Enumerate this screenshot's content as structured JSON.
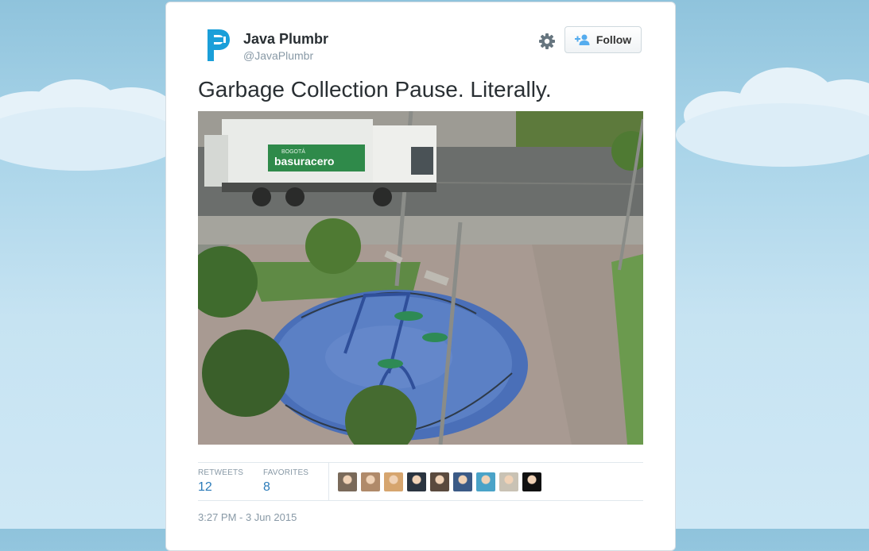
{
  "user": {
    "name": "Java Plumbr",
    "handle": "@JavaPlumbr",
    "avatar_icon": "plumbr-p-logo-icon",
    "brand_color": "#1a9fd9"
  },
  "actions": {
    "follow_label": "Follow",
    "settings_icon": "gear-icon",
    "follow_icon": "add-user-icon"
  },
  "tweet": {
    "text": "Garbage Collection Pause. Literally.",
    "media": {
      "truck_lettering_small": "BOGOTÁ",
      "truck_lettering": "basuracero"
    }
  },
  "stats": {
    "retweets_label": "RETWEETS",
    "retweets_count": "12",
    "favorites_label": "FAVORITES",
    "favorites_count": "8"
  },
  "favoriters": [
    {
      "avatar": "favoriter-avatar-1",
      "color": "#7a6a5a"
    },
    {
      "avatar": "favoriter-avatar-2",
      "color": "#b08a6a"
    },
    {
      "avatar": "favoriter-avatar-3",
      "color": "#d6a56e"
    },
    {
      "avatar": "favoriter-avatar-4",
      "color": "#2a3440"
    },
    {
      "avatar": "favoriter-avatar-5",
      "color": "#5a4a3e"
    },
    {
      "avatar": "favoriter-avatar-6",
      "color": "#3b5a86"
    },
    {
      "avatar": "favoriter-avatar-7",
      "color": "#4aa3c8"
    },
    {
      "avatar": "favoriter-avatar-8",
      "color": "#c9c2b4"
    },
    {
      "avatar": "favoriter-avatar-9",
      "color": "#111111"
    }
  ],
  "timestamp": "3:27 PM - 3 Jun 2015"
}
